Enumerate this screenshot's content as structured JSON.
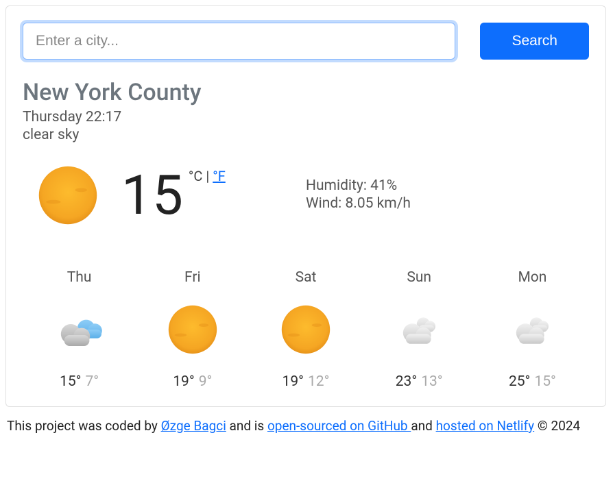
{
  "search": {
    "placeholder": "Enter a city...",
    "button": "Search"
  },
  "location": "New York County",
  "datetime": "Thursday 22:17",
  "description": "clear sky",
  "current": {
    "temp": "15",
    "unit_c": "°C",
    "unit_sep": " | ",
    "unit_f": "°F",
    "icon": "sun",
    "humidity_label": "Humidity: ",
    "humidity_value": "41%",
    "wind_label": "Wind: ",
    "wind_value": "8.05 km/h"
  },
  "forecast": [
    {
      "day": "Thu",
      "icon": "partly-cloudy",
      "high": "15°",
      "low": "7°"
    },
    {
      "day": "Fri",
      "icon": "sun",
      "high": "19°",
      "low": "9°"
    },
    {
      "day": "Sat",
      "icon": "sun",
      "high": "19°",
      "low": "12°"
    },
    {
      "day": "Sun",
      "icon": "cloudy-light",
      "high": "23°",
      "low": "13°"
    },
    {
      "day": "Mon",
      "icon": "cloudy-light",
      "high": "25°",
      "low": "15°"
    }
  ],
  "footer": {
    "prefix": "This project was coded by ",
    "author": "Øzge Bagci",
    "mid1": " and is ",
    "link1": "open-sourced on GitHub ",
    "mid2": "and ",
    "link2": "hosted on Netlify",
    "suffix": " © 2024"
  }
}
